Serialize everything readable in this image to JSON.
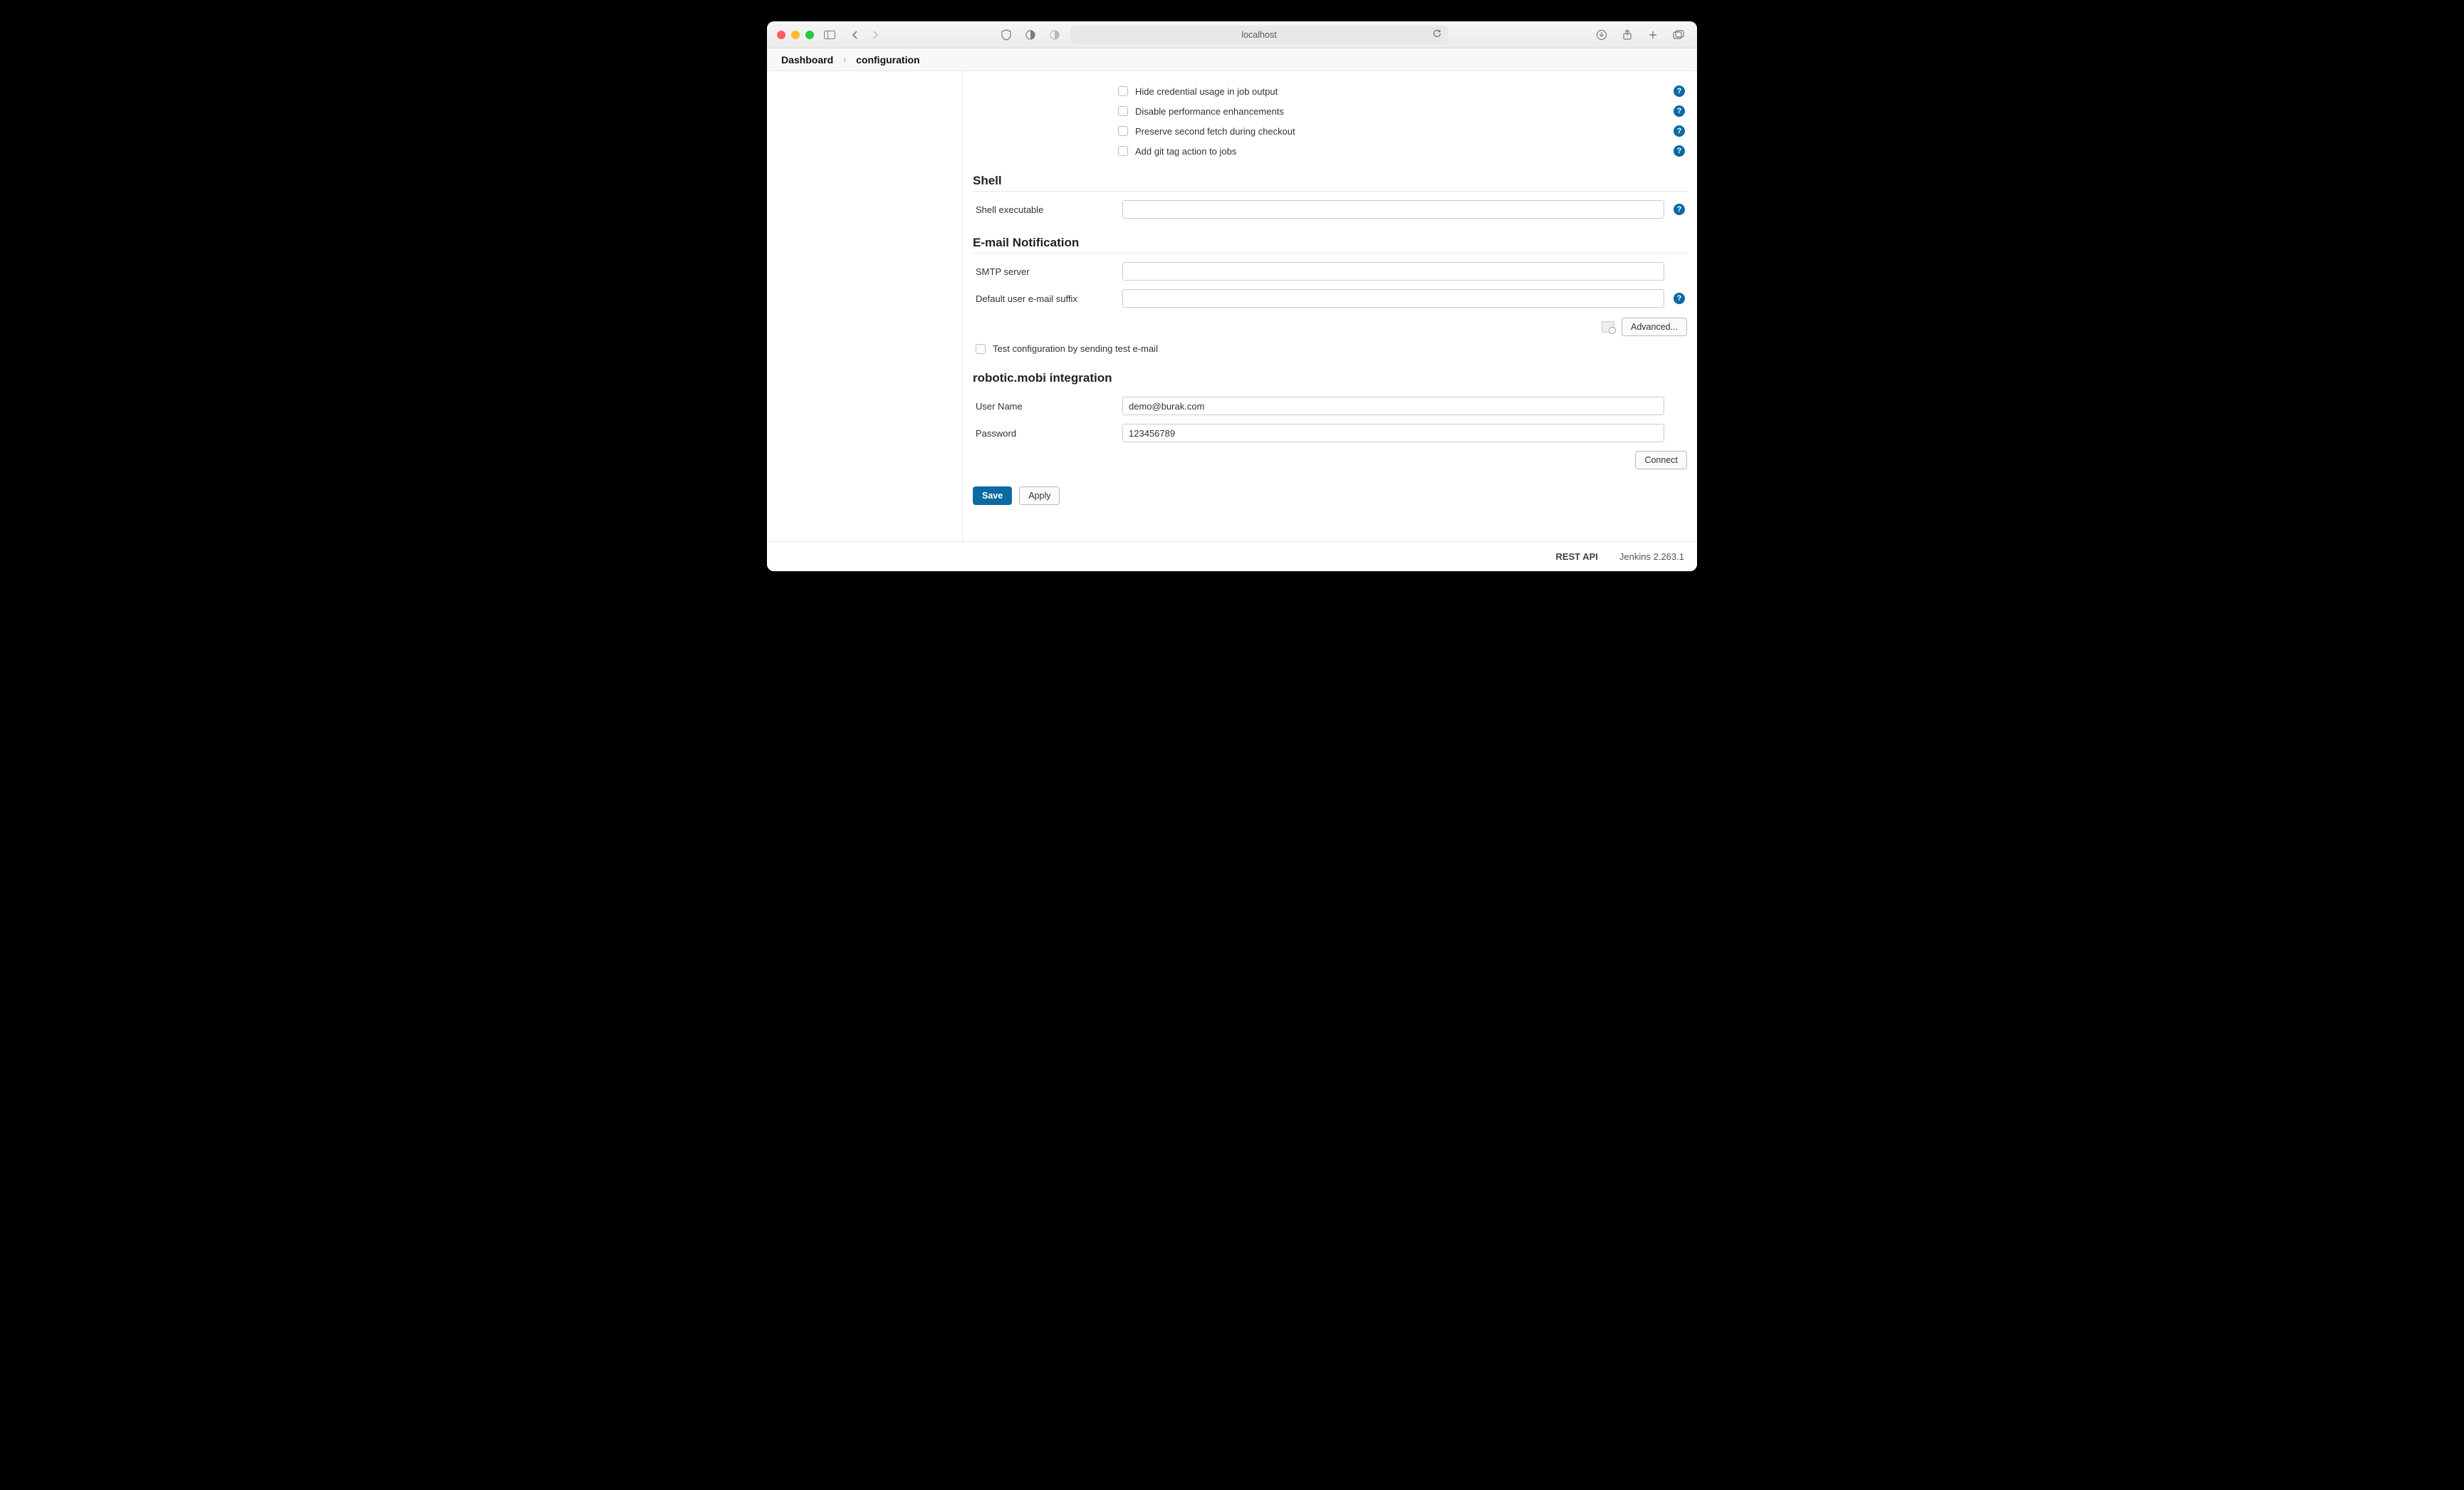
{
  "browser": {
    "address": "localhost"
  },
  "breadcrumb": {
    "root": "Dashboard",
    "page": "configuration"
  },
  "checkboxes": {
    "hide_cred": "Hide credential usage in job output",
    "disable_perf": "Disable performance enhancements",
    "preserve_fetch": "Preserve second fetch during checkout",
    "add_git_tag": "Add git tag action to jobs",
    "test_email": "Test configuration by sending test e-mail"
  },
  "sections": {
    "shell": {
      "title": "Shell",
      "exec_label": "Shell executable",
      "exec_value": ""
    },
    "email": {
      "title": "E-mail Notification",
      "smtp_label": "SMTP server",
      "smtp_value": "",
      "suffix_label": "Default user e-mail suffix",
      "suffix_value": "",
      "advanced_label": "Advanced..."
    },
    "robotic": {
      "title": "robotic.mobi integration",
      "user_label": "User Name",
      "user_value": "demo@burak.com",
      "pass_label": "Password",
      "pass_value": "123456789",
      "connect_label": "Connect"
    }
  },
  "actions": {
    "save": "Save",
    "apply": "Apply"
  },
  "footer": {
    "rest": "REST API",
    "jenkins": "Jenkins 2.263.1"
  }
}
